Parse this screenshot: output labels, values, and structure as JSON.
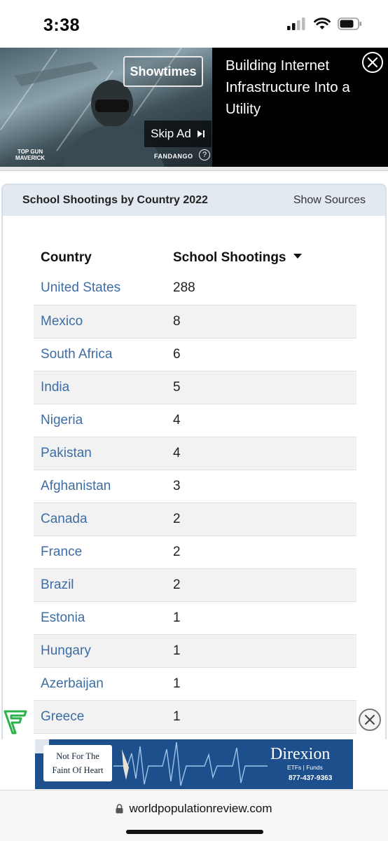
{
  "status": {
    "time": "3:38"
  },
  "video_ad": {
    "button": "Showtimes",
    "skip": "Skip Ad",
    "headline": "Building Internet Infrastructure Into a Utility",
    "sponsor_logo": "TOP GUN MAVERICK",
    "platform_logo": "FANDANGO"
  },
  "card": {
    "title": "School Shootings by Country 2022",
    "sources_link": "Show Sources",
    "columns": [
      "Country",
      "School Shootings"
    ],
    "rows": [
      {
        "country": "United States",
        "value": "288"
      },
      {
        "country": "Mexico",
        "value": "8"
      },
      {
        "country": "South Africa",
        "value": "6"
      },
      {
        "country": "India",
        "value": "5"
      },
      {
        "country": "Nigeria",
        "value": "4"
      },
      {
        "country": "Pakistan",
        "value": "4"
      },
      {
        "country": "Afghanistan",
        "value": "3"
      },
      {
        "country": "Canada",
        "value": "2"
      },
      {
        "country": "France",
        "value": "2"
      },
      {
        "country": "Brazil",
        "value": "2"
      },
      {
        "country": "Estonia",
        "value": "1"
      },
      {
        "country": "Hungary",
        "value": "1"
      },
      {
        "country": "Azerbaijan",
        "value": "1"
      },
      {
        "country": "Greece",
        "value": "1"
      }
    ]
  },
  "banner_ad": {
    "tagline_line1": "Not For The",
    "tagline_line2": "Faint Of Heart",
    "brand": "Direxion",
    "sub": "ETFs | Funds",
    "phone": "877-437-9363"
  },
  "browser": {
    "url": "worldpopulationreview.com"
  }
}
